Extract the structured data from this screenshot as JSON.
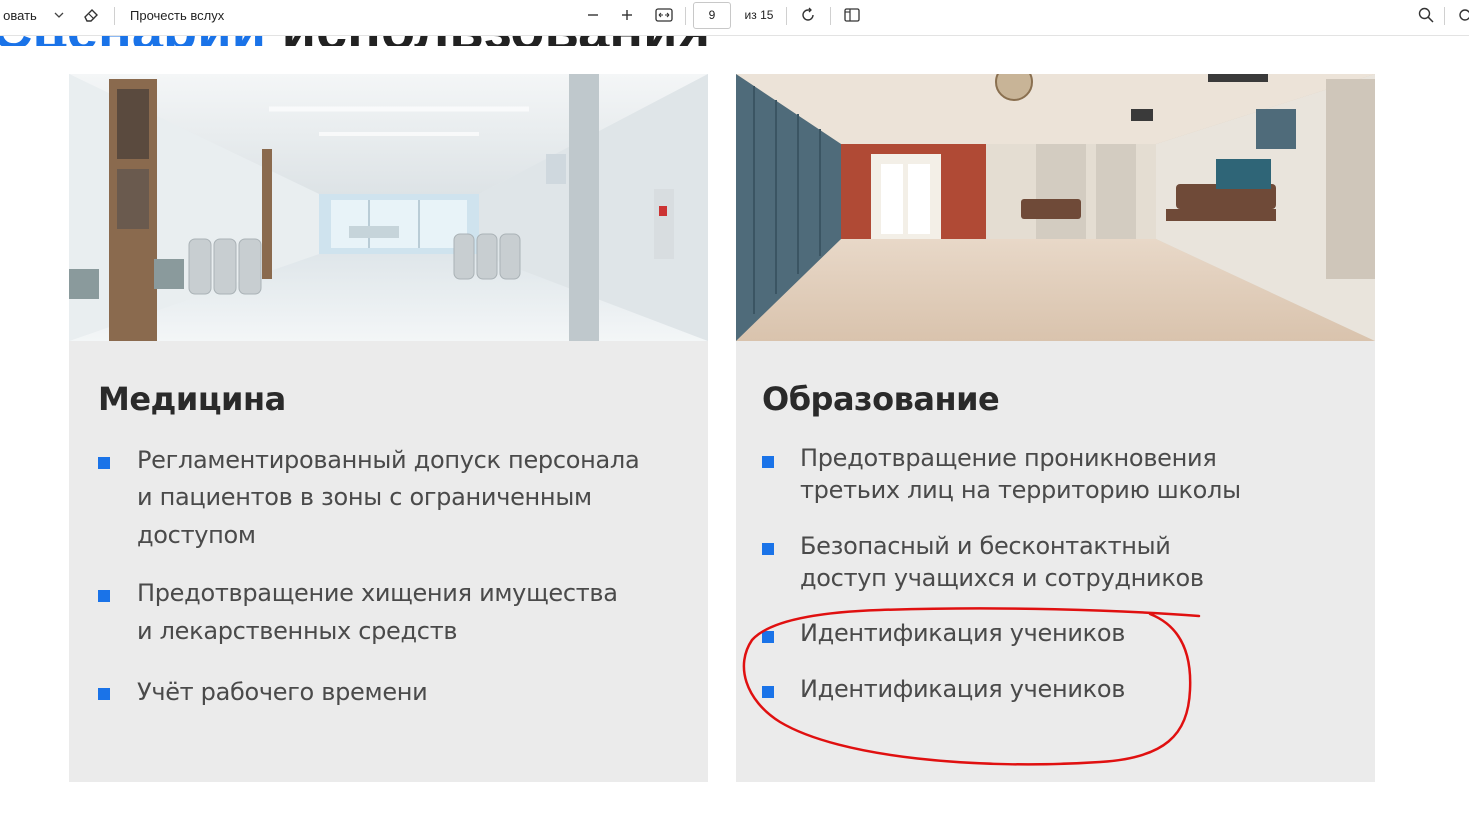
{
  "toolbar": {
    "draw_label": "овать",
    "read_aloud_label": "Прочесть вслух",
    "current_page": "9",
    "page_total_label": "из 15"
  },
  "document": {
    "title_blue": "Сценарии",
    "title_dark": " использования"
  },
  "cards": [
    {
      "heading": "Медицина",
      "image_label": "hospital-corridor",
      "bullets": [
        [
          "Регламентированный допуск персонала",
          "и пациентов в зоны с ограниченным",
          "доступом"
        ],
        [
          "Предотвращение хищения имущества",
          "и лекарственных средств"
        ],
        [
          "Учёт рабочего времени"
        ]
      ]
    },
    {
      "heading": "Образование",
      "image_label": "school-hallway",
      "bullets": [
        [
          "Предотвращение проникновения",
          "третьих лиц на территорию школы"
        ],
        [
          "Безопасный и бесконтактный",
          "доступ учащихся и сотрудников"
        ],
        [
          "Идентификация учеников"
        ],
        [
          "Идентификация учеников"
        ]
      ]
    }
  ],
  "colors": {
    "accent": "#1a73e8",
    "card_bg": "#ebebeb",
    "annotation": "#e01010"
  }
}
